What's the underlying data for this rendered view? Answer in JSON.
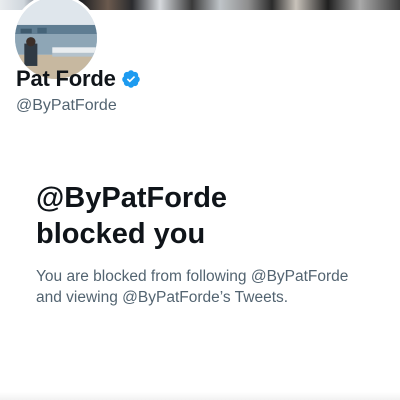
{
  "profile": {
    "display_name": "Pat Forde",
    "handle": "@ByPatForde",
    "verified": true,
    "verified_color": "#1d9bf0",
    "avatar_icon": "profile-photo"
  },
  "blocked": {
    "title_line1": "@ByPatForde",
    "title_line2": "blocked you",
    "desc_line1": "You are blocked from following @ByPatForde",
    "desc_line2": "and viewing @ByPatForde’s Tweets."
  },
  "colors": {
    "primary_text": "#0f1419",
    "secondary_text": "#536471",
    "background": "#ffffff"
  }
}
